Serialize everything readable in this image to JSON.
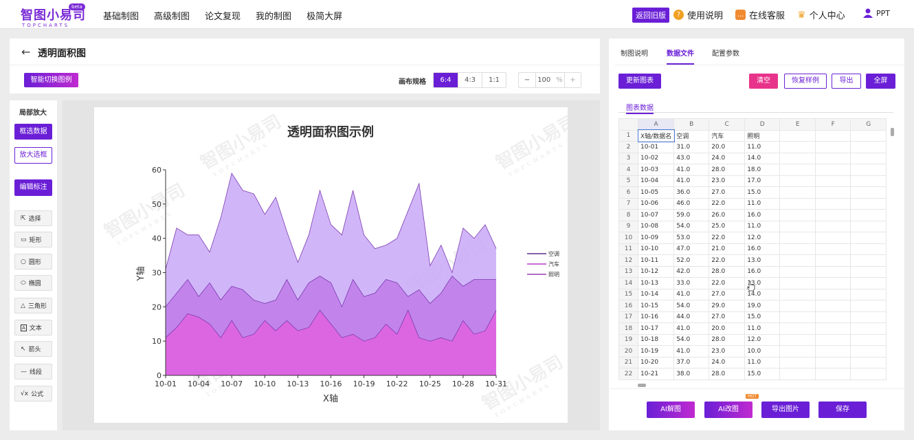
{
  "header": {
    "logo_text": "智图小易司",
    "logo_sub": "TOPCHARTS",
    "beta": "beta",
    "nav": [
      "基础制图",
      "高级制图",
      "论文复现",
      "我的制图",
      "极简大屏"
    ],
    "old_version": "返回旧版",
    "help": "使用说明",
    "support": "在线客服",
    "personal": "个人中心",
    "ppt": "PPT"
  },
  "editor": {
    "title": "透明面积图",
    "smart_switch": "智能切换图例",
    "canvas_label": "画布规格",
    "ratios": [
      "6:4",
      "4:3",
      "1:1"
    ],
    "zoom_minus": "−",
    "zoom_value": "100",
    "zoom_unit": "%",
    "zoom_plus": "+"
  },
  "left_tools": {
    "title": "局部放大",
    "select_data": "框选数据",
    "zoom_box": "放大选框",
    "edit_annot": "编辑标注",
    "items": [
      {
        "icon": "⇱",
        "label": "选择"
      },
      {
        "icon": "▭",
        "label": "矩形"
      },
      {
        "icon": "○",
        "label": "圆形"
      },
      {
        "icon": "⬭",
        "label": "椭圆"
      },
      {
        "icon": "△",
        "label": "三角形"
      },
      {
        "icon": "A",
        "label": "文本"
      },
      {
        "icon": "↖",
        "label": "箭头"
      },
      {
        "icon": "—",
        "label": "线段"
      },
      {
        "icon": "√x",
        "label": "公式"
      }
    ]
  },
  "right": {
    "tabs": [
      "制图说明",
      "数据文件",
      "配置参数"
    ],
    "update": "更新图表",
    "clear": "清空",
    "restore": "恢复样例",
    "export": "导出",
    "fullscreen": "全屏",
    "data_tab": "图表数据",
    "col_headers": [
      "A",
      "B",
      "C",
      "D",
      "E",
      "F",
      "G"
    ],
    "bottom": {
      "ai_read": "AI解图",
      "ai_edit": "AI改图",
      "hot": "HOT",
      "export_img": "导出图片",
      "save": "保存"
    }
  },
  "watermark": {
    "main": "智图小易司",
    "sub": "TOPCHARTS"
  },
  "colors": {
    "accent": "#6a1fd6",
    "clear": "#e8338b",
    "s1": "#c9a8f8",
    "s2": "#c07be8",
    "s3": "#e060e0"
  },
  "table_rows": [
    [
      "X轴/数据名",
      "空调",
      "汽车",
      "照明"
    ],
    [
      "10-01",
      "31.0",
      "20.0",
      "11.0"
    ],
    [
      "10-02",
      "43.0",
      "24.0",
      "14.0"
    ],
    [
      "10-03",
      "41.0",
      "28.0",
      "18.0"
    ],
    [
      "10-04",
      "41.0",
      "23.0",
      "17.0"
    ],
    [
      "10-05",
      "36.0",
      "27.0",
      "15.0"
    ],
    [
      "10-06",
      "46.0",
      "22.0",
      "11.0"
    ],
    [
      "10-07",
      "59.0",
      "26.0",
      "16.0"
    ],
    [
      "10-08",
      "54.0",
      "25.0",
      "11.0"
    ],
    [
      "10-09",
      "53.0",
      "22.0",
      "12.0"
    ],
    [
      "10-10",
      "47.0",
      "21.0",
      "16.0"
    ],
    [
      "10-11",
      "52.0",
      "22.0",
      "13.0"
    ],
    [
      "10-12",
      "42.0",
      "28.0",
      "16.0"
    ],
    [
      "10-13",
      "33.0",
      "22.0",
      "13.0"
    ],
    [
      "10-14",
      "41.0",
      "27.0",
      "14.0"
    ],
    [
      "10-15",
      "54.0",
      "29.0",
      "19.0"
    ],
    [
      "10-16",
      "44.0",
      "27.0",
      "15.0"
    ],
    [
      "10-17",
      "41.0",
      "20.0",
      "11.0"
    ],
    [
      "10-18",
      "54.0",
      "28.0",
      "12.0"
    ],
    [
      "10-19",
      "41.0",
      "23.0",
      "10.0"
    ],
    [
      "10-20",
      "37.0",
      "24.0",
      "11.0"
    ],
    [
      "10-21",
      "38.0",
      "28.0",
      "15.0"
    ]
  ],
  "chart_data": {
    "type": "area",
    "title": "透明面积图示例",
    "xlabel": "X轴",
    "ylabel": "Y轴",
    "ylim": [
      0,
      60
    ],
    "yticks": [
      0,
      10,
      20,
      30,
      40,
      50,
      60
    ],
    "xticks": [
      "10-01",
      "10-04",
      "10-07",
      "10-10",
      "10-13",
      "10-16",
      "10-19",
      "10-22",
      "10-25",
      "10-28",
      "10-31"
    ],
    "categories": [
      "10-01",
      "10-02",
      "10-03",
      "10-04",
      "10-05",
      "10-06",
      "10-07",
      "10-08",
      "10-09",
      "10-10",
      "10-11",
      "10-12",
      "10-13",
      "10-14",
      "10-15",
      "10-16",
      "10-17",
      "10-18",
      "10-19",
      "10-20",
      "10-21",
      "10-22",
      "10-23",
      "10-24",
      "10-25",
      "10-26",
      "10-27",
      "10-28",
      "10-29",
      "10-30",
      "10-31"
    ],
    "legend_position": "right",
    "grid": false,
    "series": [
      {
        "name": "空调",
        "color": "#c9a8f8",
        "values": [
          31,
          43,
          41,
          41,
          36,
          46,
          59,
          54,
          53,
          47,
          52,
          42,
          33,
          41,
          54,
          44,
          41,
          54,
          41,
          37,
          38,
          40,
          48,
          56,
          32,
          38,
          30,
          43,
          40,
          44,
          37
        ]
      },
      {
        "name": "汽车",
        "color": "#c07be8",
        "values": [
          20,
          24,
          28,
          23,
          27,
          22,
          26,
          25,
          22,
          21,
          22,
          28,
          22,
          27,
          29,
          27,
          20,
          28,
          23,
          24,
          28,
          27,
          23,
          25,
          21,
          24,
          29,
          26,
          28,
          28,
          28
        ]
      },
      {
        "name": "照明",
        "color": "#e060e0",
        "values": [
          11,
          14,
          18,
          17,
          15,
          11,
          16,
          11,
          12,
          16,
          13,
          16,
          13,
          14,
          19,
          15,
          11,
          12,
          10,
          11,
          15,
          12,
          19,
          11,
          10,
          11,
          10,
          16,
          12,
          13,
          19
        ]
      }
    ]
  }
}
